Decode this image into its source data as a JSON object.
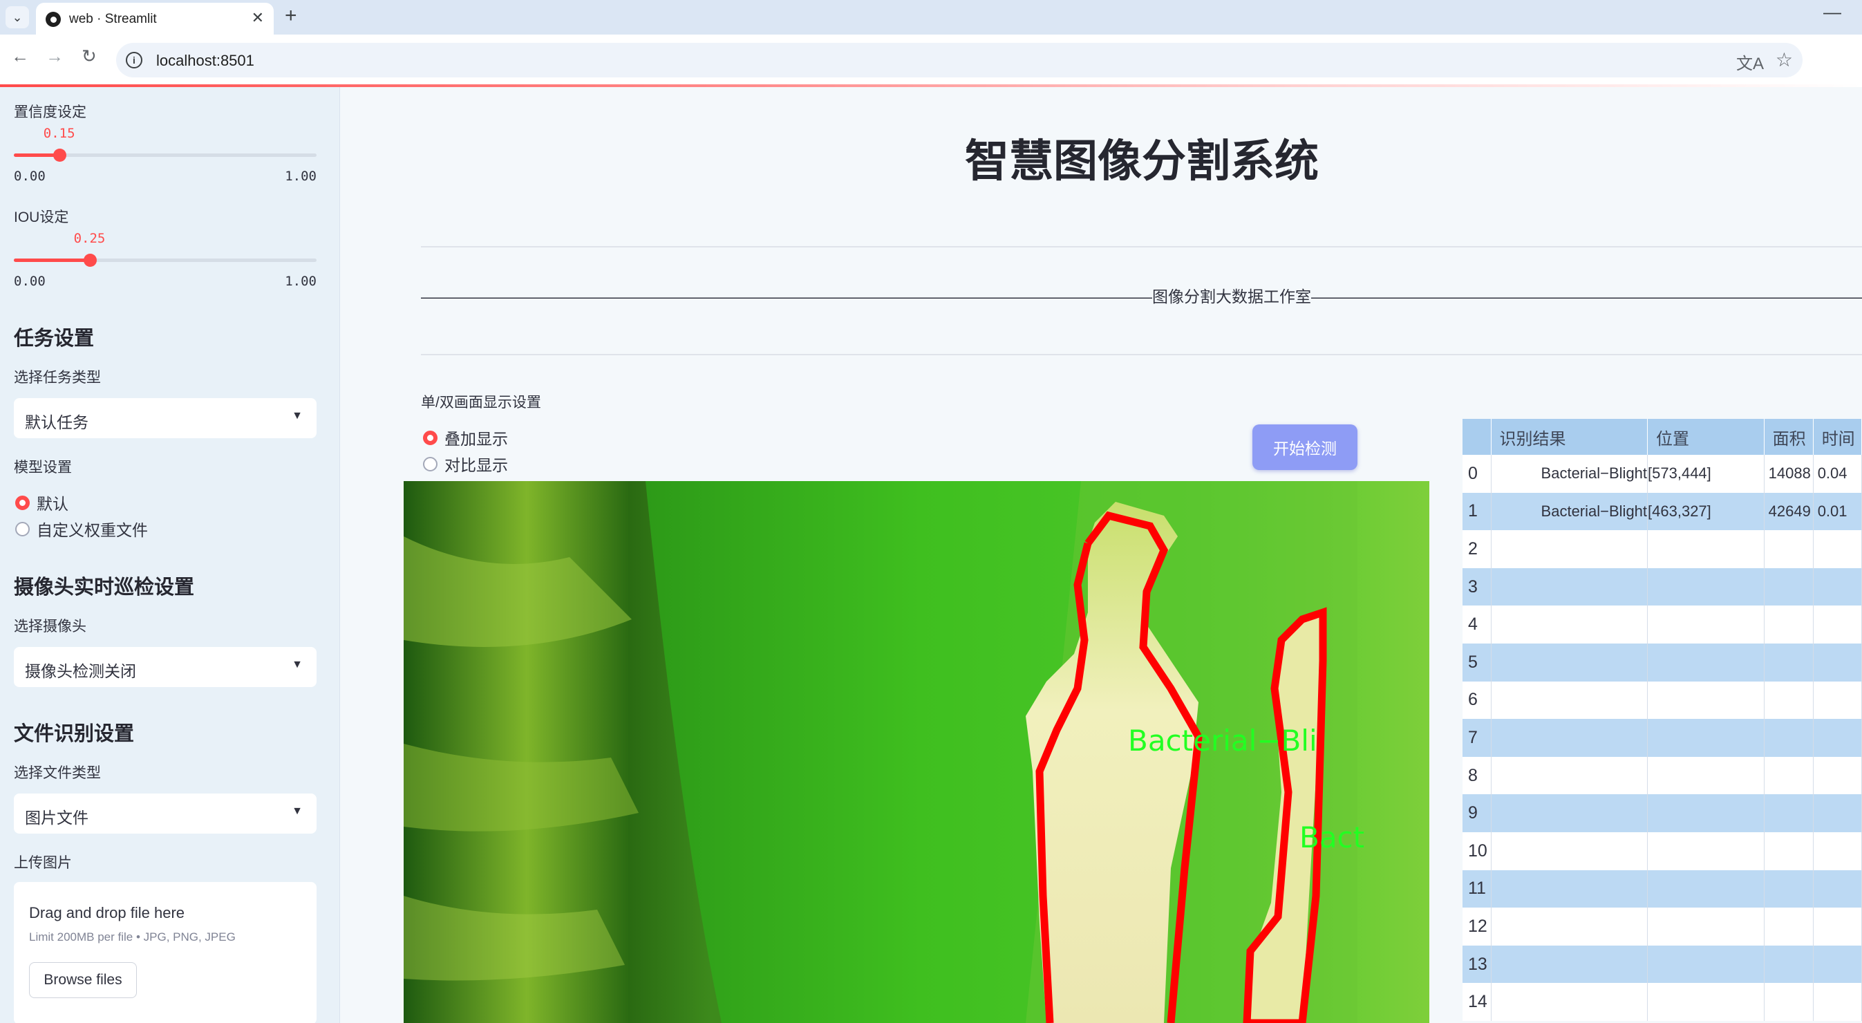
{
  "browser": {
    "tab_title": "web · Streamlit",
    "url": "localhost:8501"
  },
  "sidebar": {
    "confidence": {
      "label": "置信度设定",
      "value": "0.15",
      "min": "0.00",
      "max": "1.00",
      "fraction": 0.15
    },
    "iou": {
      "label": "IOU设定",
      "value": "0.25",
      "min": "0.00",
      "max": "1.00",
      "fraction": 0.25
    },
    "task_header": "任务设置",
    "task_type_label": "选择任务类型",
    "task_type_value": "默认任务",
    "model_label": "模型设置",
    "model_options": [
      "默认",
      "自定义权重文件"
    ],
    "model_selected": 0,
    "camera_header": "摄像头实时巡检设置",
    "camera_label": "选择摄像头",
    "camera_value": "摄像头检测关闭",
    "file_header": "文件识别设置",
    "file_type_label": "选择文件类型",
    "file_type_value": "图片文件",
    "upload_label": "上传图片",
    "upload_title": "Drag and drop file here",
    "upload_limit": "Limit 200MB per file • JPG, PNG, JPEG",
    "browse_label": "Browse files"
  },
  "main": {
    "title": "智慧图像分割系统",
    "caption": "——————————————————————————————————————————————图像分割大数据工作室——————————————————————————————————————————————————",
    "display_label": "单/双画面显示设置",
    "display_options": [
      "叠加显示",
      "对比显示"
    ],
    "display_selected": 0,
    "start_button": "开始检测",
    "overlay_labels": [
      "Bacterial−Bli",
      "Bact"
    ]
  },
  "table": {
    "columns": [
      "",
      "识别结果",
      "位置",
      "面积",
      "时间"
    ],
    "rows": [
      {
        "idx": "0",
        "cls": "Bacterial−Blight",
        "pos": "[573,444]",
        "area": "14088",
        "time": "0.04"
      },
      {
        "idx": "1",
        "cls": "Bacterial−Blight",
        "pos": "[463,327]",
        "area": "42649",
        "time": "0.01"
      },
      {
        "idx": "2",
        "cls": "",
        "pos": "",
        "area": "",
        "time": ""
      },
      {
        "idx": "3",
        "cls": "",
        "pos": "",
        "area": "",
        "time": ""
      },
      {
        "idx": "4",
        "cls": "",
        "pos": "",
        "area": "",
        "time": ""
      },
      {
        "idx": "5",
        "cls": "",
        "pos": "",
        "area": "",
        "time": ""
      },
      {
        "idx": "6",
        "cls": "",
        "pos": "",
        "area": "",
        "time": ""
      },
      {
        "idx": "7",
        "cls": "",
        "pos": "",
        "area": "",
        "time": ""
      },
      {
        "idx": "8",
        "cls": "",
        "pos": "",
        "area": "",
        "time": ""
      },
      {
        "idx": "9",
        "cls": "",
        "pos": "",
        "area": "",
        "time": ""
      },
      {
        "idx": "10",
        "cls": "",
        "pos": "",
        "area": "",
        "time": ""
      },
      {
        "idx": "11",
        "cls": "",
        "pos": "",
        "area": "",
        "time": ""
      },
      {
        "idx": "12",
        "cls": "",
        "pos": "",
        "area": "",
        "time": ""
      },
      {
        "idx": "13",
        "cls": "",
        "pos": "",
        "area": "",
        "time": ""
      },
      {
        "idx": "14",
        "cls": "",
        "pos": "",
        "area": "",
        "time": ""
      }
    ]
  },
  "colors": {
    "accent": "#ff4b4b",
    "button": "#8e9cf5",
    "table_header": "#a9cdee",
    "table_alt_row": "#bcd9f3",
    "mask_outline": "#ff0000",
    "label_text": "#22ff22"
  },
  "icons": [
    "tab-dropdown-icon",
    "favicon-icon",
    "close-icon",
    "plus-icon",
    "back-icon",
    "forward-icon",
    "reload-icon",
    "info-icon",
    "translate-icon",
    "star-icon",
    "chevron-down-icon"
  ]
}
